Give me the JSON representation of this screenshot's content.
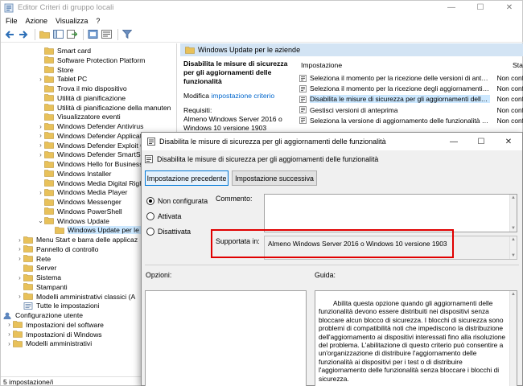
{
  "window": {
    "title": "Editor Criteri di gruppo locali",
    "minimize": "—",
    "maximize": "☐",
    "close": "✕"
  },
  "menu": [
    "File",
    "Azione",
    "Visualizza",
    "?"
  ],
  "tree": {
    "items": [
      {
        "label": "Smart card",
        "chev": ""
      },
      {
        "label": "Software Protection Platform",
        "chev": ""
      },
      {
        "label": "Store",
        "chev": ""
      },
      {
        "label": "Tablet PC",
        "chev": "›"
      },
      {
        "label": "Trova il mio dispositivo",
        "chev": ""
      },
      {
        "label": "Utilità di pianificazione",
        "chev": ""
      },
      {
        "label": "Utilità di pianificazione della manuten",
        "chev": ""
      },
      {
        "label": "Visualizzatore eventi",
        "chev": ""
      },
      {
        "label": "Windows Defender Antivirus",
        "chev": "›"
      },
      {
        "label": "Windows Defender Applicati",
        "chev": "›"
      },
      {
        "label": "Windows Defender Exploit G",
        "chev": "›"
      },
      {
        "label": "Windows Defender SmartScr",
        "chev": "›"
      },
      {
        "label": "Windows Hello for Business",
        "chev": ""
      },
      {
        "label": "Windows Installer",
        "chev": ""
      },
      {
        "label": "Windows Media Digital Righ",
        "chev": ""
      },
      {
        "label": "Windows Media Player",
        "chev": "›"
      },
      {
        "label": "Windows Messenger",
        "chev": ""
      },
      {
        "label": "Windows PowerShell",
        "chev": ""
      },
      {
        "label": "Windows Update",
        "chev": "⌄"
      },
      {
        "label": "Windows Update per le azi",
        "chev": ""
      },
      {
        "label": "Menu Start e barra delle applicaz",
        "chev": "›"
      },
      {
        "label": "Pannello di controllo",
        "chev": "›"
      },
      {
        "label": "Rete",
        "chev": "›"
      },
      {
        "label": "Server",
        "chev": ""
      },
      {
        "label": "Sistema",
        "chev": "›"
      },
      {
        "label": "Stampanti",
        "chev": ""
      },
      {
        "label": "Modelli amministrativi classici (A",
        "chev": "›"
      },
      {
        "label": "Tutte le impostazioni",
        "chev": ""
      },
      {
        "label": "Configurazione utente",
        "chev": "⌄"
      },
      {
        "label": "Impostazioni del software",
        "chev": "›"
      },
      {
        "label": "Impostazioni di Windows",
        "chev": "›"
      },
      {
        "label": "Modelli amministrativi",
        "chev": "›"
      }
    ]
  },
  "pane": {
    "header": "Windows Update per le aziende",
    "policy_title": "Disabilita le misure di sicurezza per gli aggiornamenti delle funzionalità",
    "edit_prefix": "Modifica ",
    "edit_link": "impostazione criterio",
    "requirements_label": "Requisiti:",
    "requirements": "Almeno Windows Server 2016 o Windows 10 versione 1903",
    "col_setting": "Impostazione",
    "col_state": "Stat",
    "settings": [
      {
        "name": "Seleziona il momento per la ricezione delle versioni di antep...",
        "state": "Non conf"
      },
      {
        "name": "Seleziona il momento per la ricezione degli aggiornamenti qu...",
        "state": "Non conf"
      },
      {
        "name": "Disabilita le misure di sicurezza per gli aggiornamenti delle f...",
        "state": "Non conf"
      },
      {
        "name": "Gestisci versioni di anteprima",
        "state": "Non conf"
      },
      {
        "name": "Seleziona la versione di aggiornamento delle funzionalità di ...",
        "state": "Non conf"
      }
    ]
  },
  "status": "5 impostazione/i",
  "dialog": {
    "title": "Disabilita le misure di sicurezza per gli aggiornamenti delle funzionalità",
    "subtitle": "Disabilita le misure di sicurezza per gli aggiornamenti delle funzionalità",
    "btn_prev": "Impostazione precedente",
    "btn_next": "Impostazione successiva",
    "radio_not_configured": "Non configurata",
    "radio_enabled": "Attivata",
    "radio_disabled": "Disattivata",
    "comment_label": "Commento:",
    "supported_label": "Supportata in:",
    "supported_value": "Almeno Windows Server 2016 o Windows 10 versione 1903",
    "options_label": "Opzioni:",
    "guide_label": "Guida:",
    "guide_text": "Abilita questa opzione quando gli aggiornamenti delle funzionalità devono essere distribuiti nei dispositivi senza bloccare alcun blocco di sicurezza. I blocchi di sicurezza sono problemi di compatibilità noti che impediscono la distribuzione dell'aggiornamento ai dispositivi interessati fino alla risoluzione del problema. L'abilitazione di questo criterio può consentire a un'organizzazione di distribuire l'aggiornamento delle funzionalità ai dispositivi per i test o di distribuire l'aggiornamento delle funzionalità senza bloccare i blocchi di sicurezza."
  },
  "colors": {
    "accent": "#0078d7",
    "highlight": "#e00000",
    "selection": "#cce8ff",
    "folder": "#e8c15a"
  }
}
